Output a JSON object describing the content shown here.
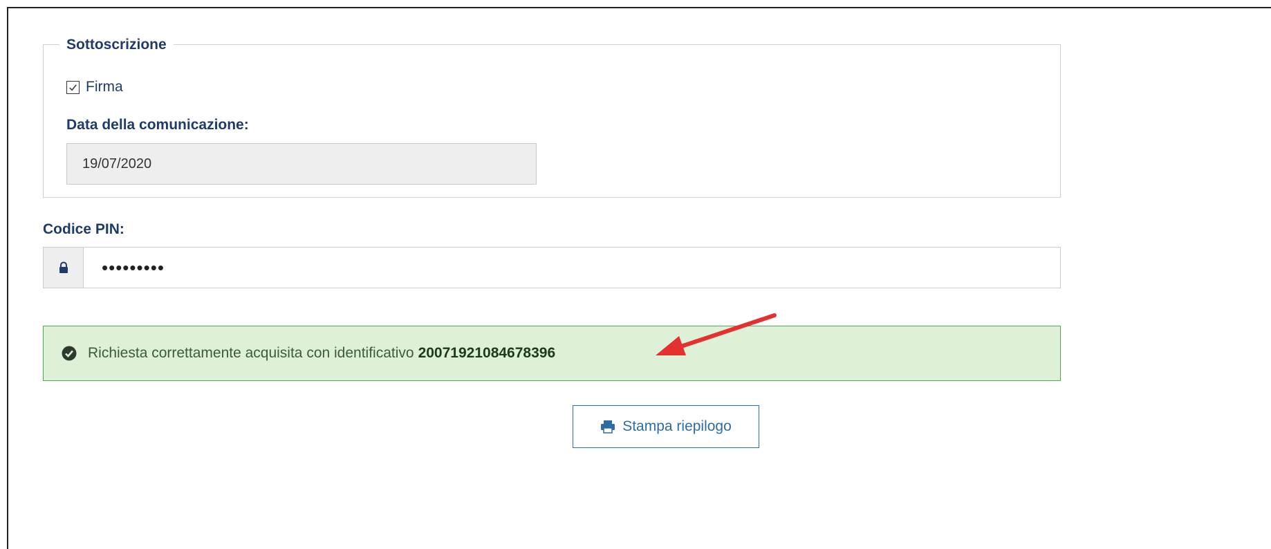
{
  "fieldset": {
    "legend": "Sottoscrizione",
    "checkbox_label": "Firma",
    "checkbox_checked": true,
    "date_label": "Data della comunicazione:",
    "date_value": "19/07/2020"
  },
  "pin": {
    "label": "Codice PIN:",
    "masked_value": "•••••••••",
    "icon": "lock-icon"
  },
  "alert": {
    "icon": "check-circle-icon",
    "message": "Richiesta correttamente acquisita con identificativo",
    "identifier": "20071921084678396",
    "background_color": "#dff0d8",
    "border_color": "#4cae4c"
  },
  "annotation": {
    "icon": "red-arrow-icon",
    "color": "#e53030"
  },
  "print_button": {
    "label": "Stampa riepilogo",
    "icon": "printer-icon"
  },
  "colors": {
    "label_blue": "#1f3b6b",
    "button_blue": "#2e6da4"
  }
}
